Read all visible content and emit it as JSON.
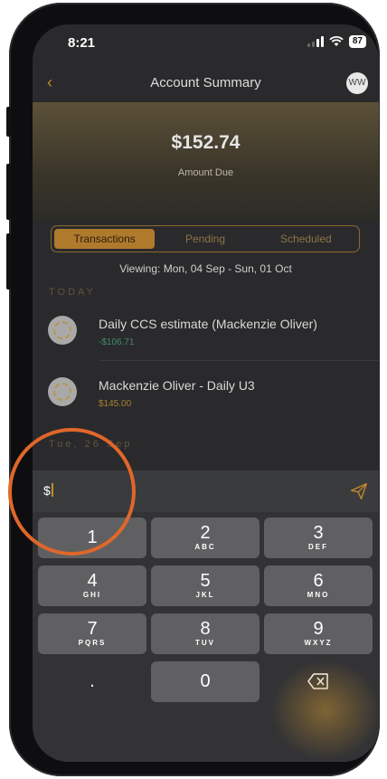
{
  "status": {
    "time": "8:21",
    "battery": "87"
  },
  "nav": {
    "back": "‹",
    "title": "Account Summary",
    "avatar": "WW"
  },
  "summary": {
    "amount": "$152.74",
    "label": "Amount Due"
  },
  "tabs": [
    {
      "label": "Transactions",
      "active": true
    },
    {
      "label": "Pending",
      "active": false
    },
    {
      "label": "Scheduled",
      "active": false
    }
  ],
  "viewing": "Viewing: Mon, 04 Sep - Sun, 01 Oct",
  "sections": {
    "today": "TODAY",
    "tue": "Tue, 26 Sep"
  },
  "transactions": [
    {
      "title": "Daily CCS estimate (Mackenzie Oliver)",
      "amount": "-$106.71",
      "amount_color": "#3f8a6b"
    },
    {
      "title": "Mackenzie Oliver - Daily U3",
      "amount": "$145.00",
      "amount_color": "#a8812e"
    }
  ],
  "input": {
    "value": "$"
  },
  "keypad": [
    {
      "num": "1",
      "letters": ""
    },
    {
      "num": "2",
      "letters": "ABC"
    },
    {
      "num": "3",
      "letters": "DEF"
    },
    {
      "num": "4",
      "letters": "GHI"
    },
    {
      "num": "5",
      "letters": "JKL"
    },
    {
      "num": "6",
      "letters": "MNO"
    },
    {
      "num": "7",
      "letters": "PQRS"
    },
    {
      "num": "8",
      "letters": "TUV"
    },
    {
      "num": "9",
      "letters": "WXYZ"
    },
    {
      "num": ".",
      "letters": ""
    },
    {
      "num": "0",
      "letters": ""
    }
  ],
  "colors": {
    "accent": "#c58a2a",
    "annotation": "#e0672a"
  }
}
